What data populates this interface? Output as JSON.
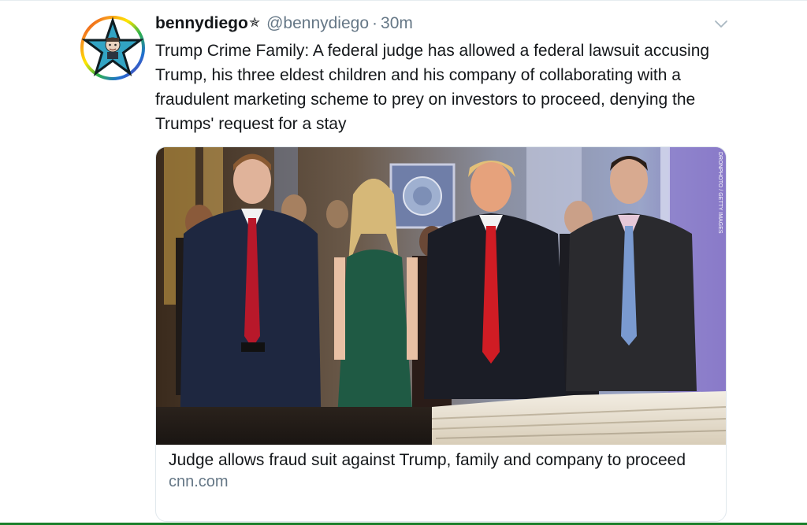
{
  "tweet": {
    "display_name": "bennydiego",
    "name_badge": "✯",
    "handle": "@bennydiego",
    "separator": "·",
    "time": "30m",
    "text": "Trump Crime Family: A federal judge has allowed a federal lawsuit accusing Trump, his three eldest children and his company of collaborating with a fraudulent marketing scheme to prey on investors to proceed, denying the Trumps' request for a stay",
    "avatar_icon": "star-avatar-icon",
    "menu_icon": "chevron-down-icon"
  },
  "card": {
    "title": "Judge allows fraud suit against Trump, family and company to proceed",
    "domain": "cnn.com",
    "image_icon": "news-photo",
    "photo_credit": "DRONPHOTO / GETTY IMAGES"
  },
  "colors": {
    "text": "#14171a",
    "secondary": "#657786",
    "border": "#e1e8ed",
    "footer_accent": "#1a7f2a"
  }
}
